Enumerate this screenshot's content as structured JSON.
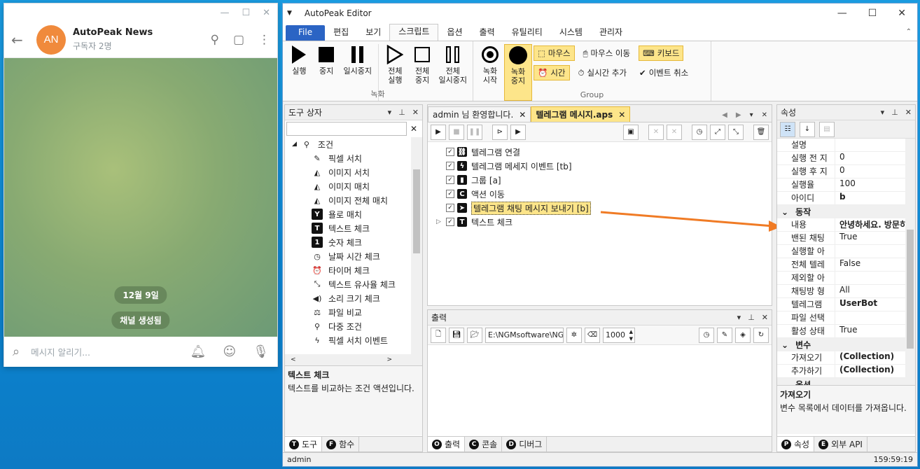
{
  "telegram": {
    "window_controls": [
      "—",
      "☐",
      "✕"
    ],
    "avatar_initials": "AN",
    "channel_name": "AutoPeak News",
    "subscribers": "구독자 2명",
    "date_pill": "12월 9일",
    "system_pill": "채널 생성됨",
    "input_placeholder": "메시지 알리기..."
  },
  "editor": {
    "title": "AutoPeak Editor",
    "menus": [
      "File",
      "편집",
      "보기",
      "스크립트",
      "옵션",
      "출력",
      "유틸리티",
      "시스템",
      "관리자"
    ],
    "active_menu": "스크립트",
    "ribbon": {
      "record_group": "녹화",
      "run": "실행",
      "stop": "중지",
      "pause": "일시중지",
      "run_all_1": "전체",
      "run_all_2": "실행",
      "stop_all_1": "전체",
      "stop_all_2": "중지",
      "pause_all_1": "전체",
      "pause_all_2": "일시중지",
      "rec_start_1": "녹화",
      "rec_start_2": "시작",
      "rec_stop_1": "녹화",
      "rec_stop_2": "중지",
      "group_label": "Group",
      "mouse": "마우스",
      "mouse_move": "마우스 이동",
      "keyboard": "키보드",
      "time": "시간",
      "realtime_add": "실시간 추가",
      "event_cancel": "이벤트 취소"
    },
    "toolbox": {
      "title": "도구 상자",
      "root": "조건",
      "items": [
        "픽셀 서치",
        "이미지 서치",
        "이미지 매치",
        "이미지 전체 매치",
        "욜로 매치",
        "텍스트 체크",
        "숫자 체크",
        "날짜 시간 체크",
        "타이머 체크",
        "텍스트 유사율 체크",
        "소리 크기 체크",
        "파일 비교",
        "다중 조건",
        "픽셀 서치 이벤트"
      ],
      "icons": [
        "✎",
        "◭",
        "◭",
        "◭",
        "Y",
        "T",
        "1",
        "◷",
        "⏰",
        "⤡",
        "◀)",
        "⚖",
        "⚲",
        "ϟ"
      ],
      "desc_title": "텍스트 체크",
      "desc_text": "텍스트를 비교하는 조건 액션입니다.",
      "tab_tools": "도구",
      "tab_funcs": "함수"
    },
    "doc_tabs": {
      "welcome": "admin 님 환영합니다.",
      "script": "텔레그램 메시지.aps"
    },
    "actions": [
      {
        "label": "텔레그램 연결",
        "icon": "⛓"
      },
      {
        "label": "텔레그램 메세지 이벤트 [tb]",
        "icon": "ϟ"
      },
      {
        "label": "그룹 [a]",
        "icon": "▮"
      },
      {
        "label": "액션 이동",
        "icon": "C"
      },
      {
        "label": "텔레그램 채팅 메시지 보내기 [b]",
        "icon": "➤"
      },
      {
        "label": "텍스트 체크",
        "icon": "T"
      }
    ],
    "output": {
      "title": "출력",
      "path": "E:\\NGMsoftware\\NG",
      "count": "1000",
      "tab_output": "출력",
      "tab_console": "콘솔",
      "tab_debug": "디버그"
    },
    "properties": {
      "title": "속성",
      "rows_top": [
        {
          "k": "설명",
          "v": ""
        },
        {
          "k": "실행 전 지",
          "v": "0"
        },
        {
          "k": "실행 후 지",
          "v": "0"
        },
        {
          "k": "실행율",
          "v": "100"
        },
        {
          "k": "아이디",
          "v": "b"
        }
      ],
      "cat_action": "동작",
      "rows_action": [
        {
          "k": "내용",
          "v": "안녕하세요. 방문히"
        },
        {
          "k": "밴된 채팅",
          "v": "True"
        },
        {
          "k": "실행할 아",
          "v": ""
        },
        {
          "k": "전체 텔레",
          "v": "False"
        },
        {
          "k": "제외할 아",
          "v": ""
        },
        {
          "k": "채팅방 형",
          "v": "All"
        },
        {
          "k": "텔레그램",
          "v": "UserBot"
        },
        {
          "k": "파일 선택",
          "v": ""
        },
        {
          "k": "활성 상태",
          "v": "True"
        }
      ],
      "cat_vars": "변수",
      "rows_vars": [
        {
          "k": "가져오기",
          "v": "(Collection)"
        },
        {
          "k": "추가하기",
          "v": "(Collection)"
        }
      ],
      "cat_opts": "옵션",
      "desc_title": "가져오기",
      "desc_text": "변수 목록에서 데이터를 가져옵니다.",
      "tab_props": "속성",
      "tab_api": "외부 API"
    },
    "status_user": "admin",
    "status_clock": "159:59:19",
    "colors": {
      "highlight": "#fde58a",
      "arrow": "#f07b25",
      "file_menu": "#2b64c4"
    }
  }
}
